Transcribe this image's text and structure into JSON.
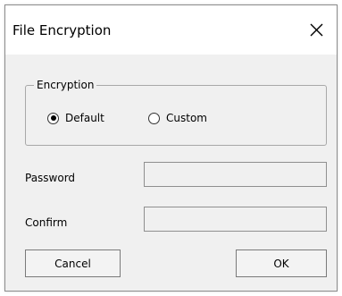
{
  "window": {
    "title": "File Encryption"
  },
  "encryption_group": {
    "label": "Encryption",
    "options": [
      {
        "label": "Default",
        "checked": true
      },
      {
        "label": "Custom",
        "checked": false
      }
    ]
  },
  "fields": {
    "password": {
      "label": "Password",
      "value": ""
    },
    "confirm": {
      "label": "Confirm",
      "value": ""
    }
  },
  "buttons": {
    "cancel": "Cancel",
    "ok": "OK"
  },
  "icons": {
    "close": "close-icon"
  }
}
